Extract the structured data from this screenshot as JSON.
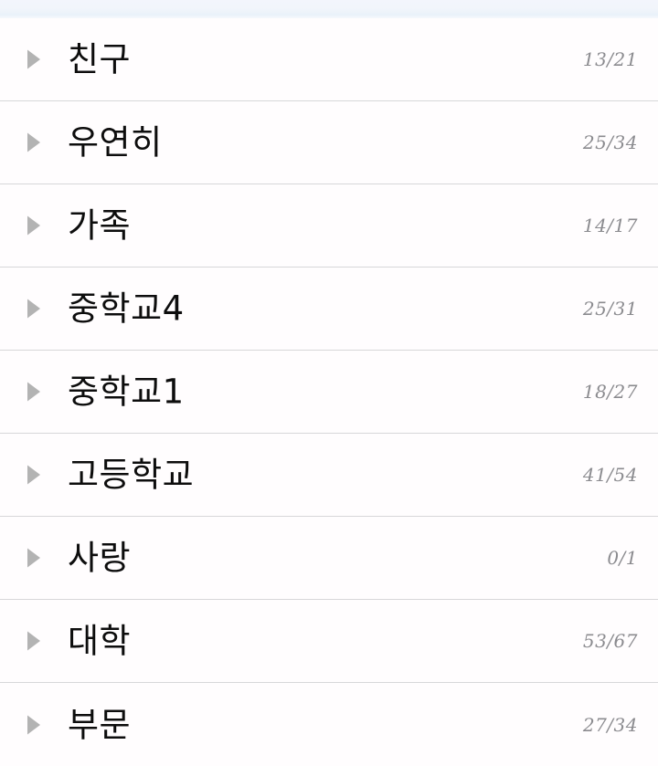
{
  "window": {
    "background_color": "#fffdfe",
    "top_band_color": "#f2f5fb"
  },
  "list": {
    "divider_color": "#d7d7d9",
    "label_color": "#0d0d0d",
    "count_color": "#8b8b8f",
    "disclosure_icon_color": "#b3b3b3",
    "disclosure_icon_name": "triangle-right-icon",
    "rows": [
      {
        "label": "친구",
        "count": "13/21",
        "done": 13,
        "total": 21,
        "expanded": false
      },
      {
        "label": "우연히",
        "count": "25/34",
        "done": 25,
        "total": 34,
        "expanded": false
      },
      {
        "label": "가족",
        "count": "14/17",
        "done": 14,
        "total": 17,
        "expanded": false
      },
      {
        "label": "중학교4",
        "count": "25/31",
        "done": 25,
        "total": 31,
        "expanded": false
      },
      {
        "label": "중학교1",
        "count": "18/27",
        "done": 18,
        "total": 27,
        "expanded": false
      },
      {
        "label": "고등학교",
        "count": "41/54",
        "done": 41,
        "total": 54,
        "expanded": false
      },
      {
        "label": "사랑",
        "count": "0/1",
        "done": 0,
        "total": 1,
        "expanded": false
      },
      {
        "label": "대학",
        "count": "53/67",
        "done": 53,
        "total": 67,
        "expanded": false
      },
      {
        "label": "부문",
        "count": "27/34",
        "done": 27,
        "total": 34,
        "expanded": false
      }
    ]
  }
}
